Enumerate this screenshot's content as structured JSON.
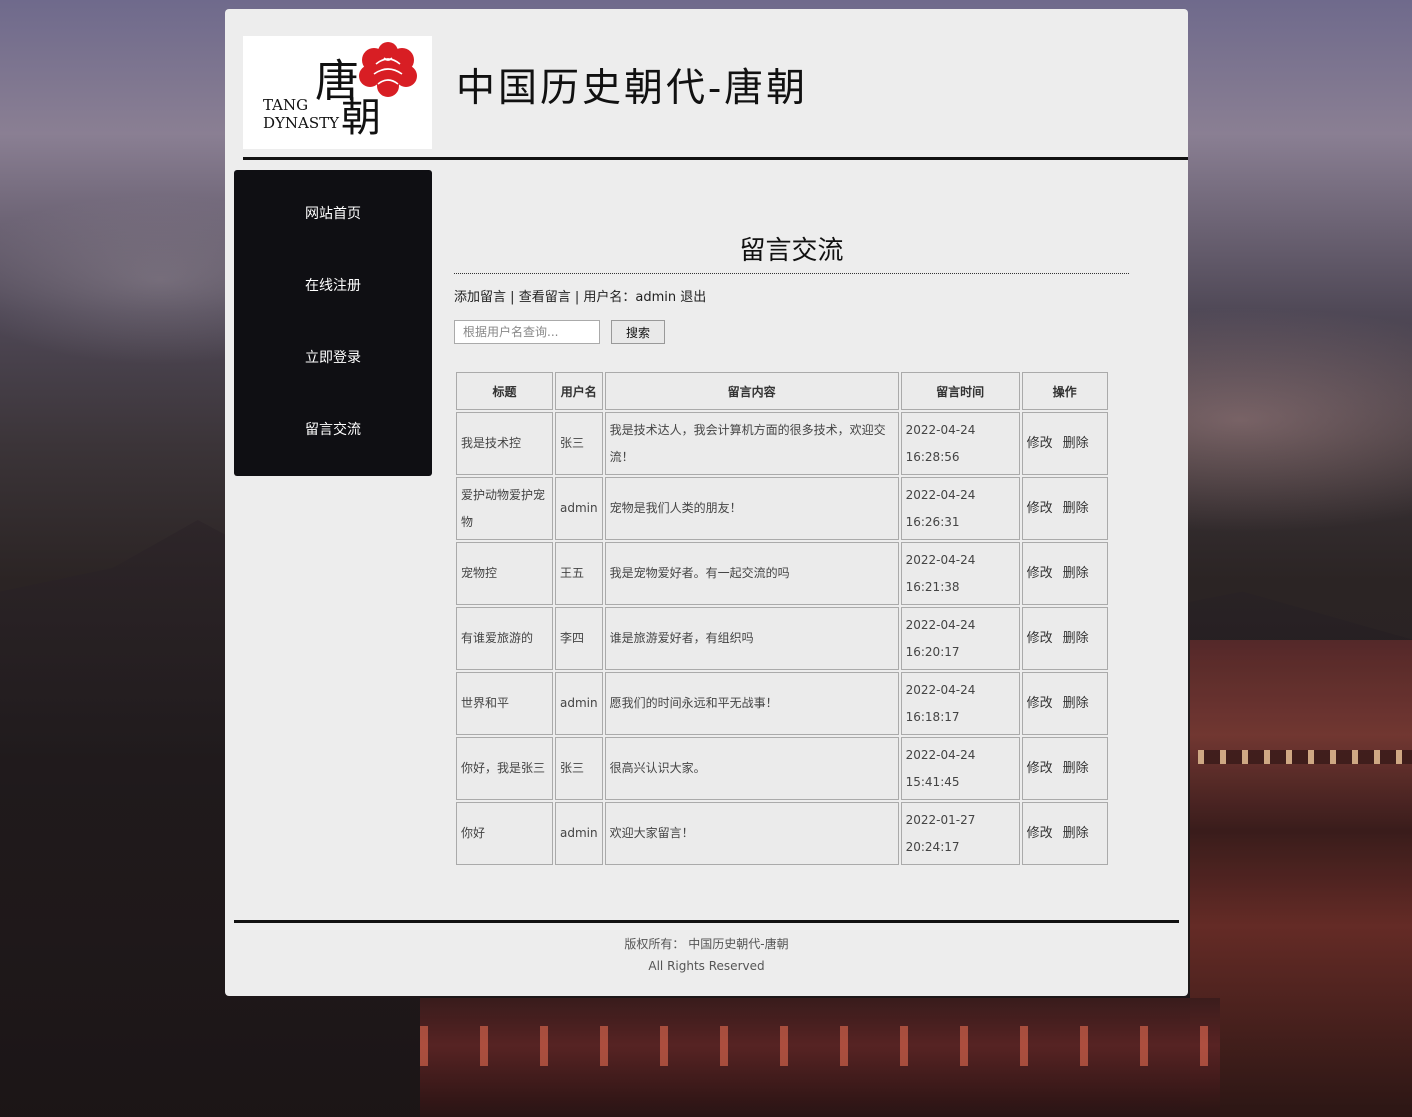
{
  "header": {
    "site_title": "中国历史朝代-唐朝",
    "logo": {
      "char1": "唐",
      "char2": "朝",
      "en_line1": "TANG",
      "en_line2": "DYNASTY"
    }
  },
  "sidebar": {
    "items": [
      {
        "label": "网站首页"
      },
      {
        "label": "在线注册"
      },
      {
        "label": "立即登录"
      },
      {
        "label": "留言交流"
      }
    ]
  },
  "main": {
    "heading": "留言交流",
    "toolbar": {
      "add_label": "添加留言",
      "view_label": "查看留言",
      "user_label": "用户名：admin",
      "logout_label": "退出",
      "separator": "|"
    },
    "search": {
      "placeholder": "根据用户名查询...",
      "button_label": "搜索"
    },
    "table": {
      "headers": [
        "标题",
        "用户名",
        "留言内容",
        "留言时间",
        "操作"
      ],
      "rows": [
        {
          "title": "我是技术控",
          "user": "张三",
          "content": "我是技术达人，我会计算机方面的很多技术，欢迎交流！",
          "date": "2022-04-24",
          "time": "16:28:56",
          "edit": "修改",
          "delete": "删除"
        },
        {
          "title": "爱护动物爱护宠物",
          "user": "admin",
          "content": "宠物是我们人类的朋友！",
          "date": "2022-04-24",
          "time": "16:26:31",
          "edit": "修改",
          "delete": "删除"
        },
        {
          "title": "宠物控",
          "user": "王五",
          "content": "我是宠物爱好者。有一起交流的吗",
          "date": "2022-04-24",
          "time": "16:21:38",
          "edit": "修改",
          "delete": "删除"
        },
        {
          "title": "有谁爱旅游的",
          "user": "李四",
          "content": "谁是旅游爱好者，有组织吗",
          "date": "2022-04-24",
          "time": "16:20:17",
          "edit": "修改",
          "delete": "删除"
        },
        {
          "title": "世界和平",
          "user": "admin",
          "content": "愿我们的时间永远和平无战事！",
          "date": "2022-04-24",
          "time": "16:18:17",
          "edit": "修改",
          "delete": "删除"
        },
        {
          "title": "你好，我是张三",
          "user": "张三",
          "content": "很高兴认识大家。",
          "date": "2022-04-24",
          "time": "15:41:45",
          "edit": "修改",
          "delete": "删除"
        },
        {
          "title": "你好",
          "user": "admin",
          "content": "欢迎大家留言！",
          "date": "2022-01-27",
          "time": "20:24:17",
          "edit": "修改",
          "delete": "删除"
        }
      ]
    }
  },
  "footer": {
    "copyright": "版权所有： 中国历史朝代-唐朝",
    "rights": "All Rights Reserved"
  },
  "colors": {
    "panel_bg": "#ededed",
    "sidebar_bg": "#0f0f13",
    "logo_red": "#d81e24"
  }
}
